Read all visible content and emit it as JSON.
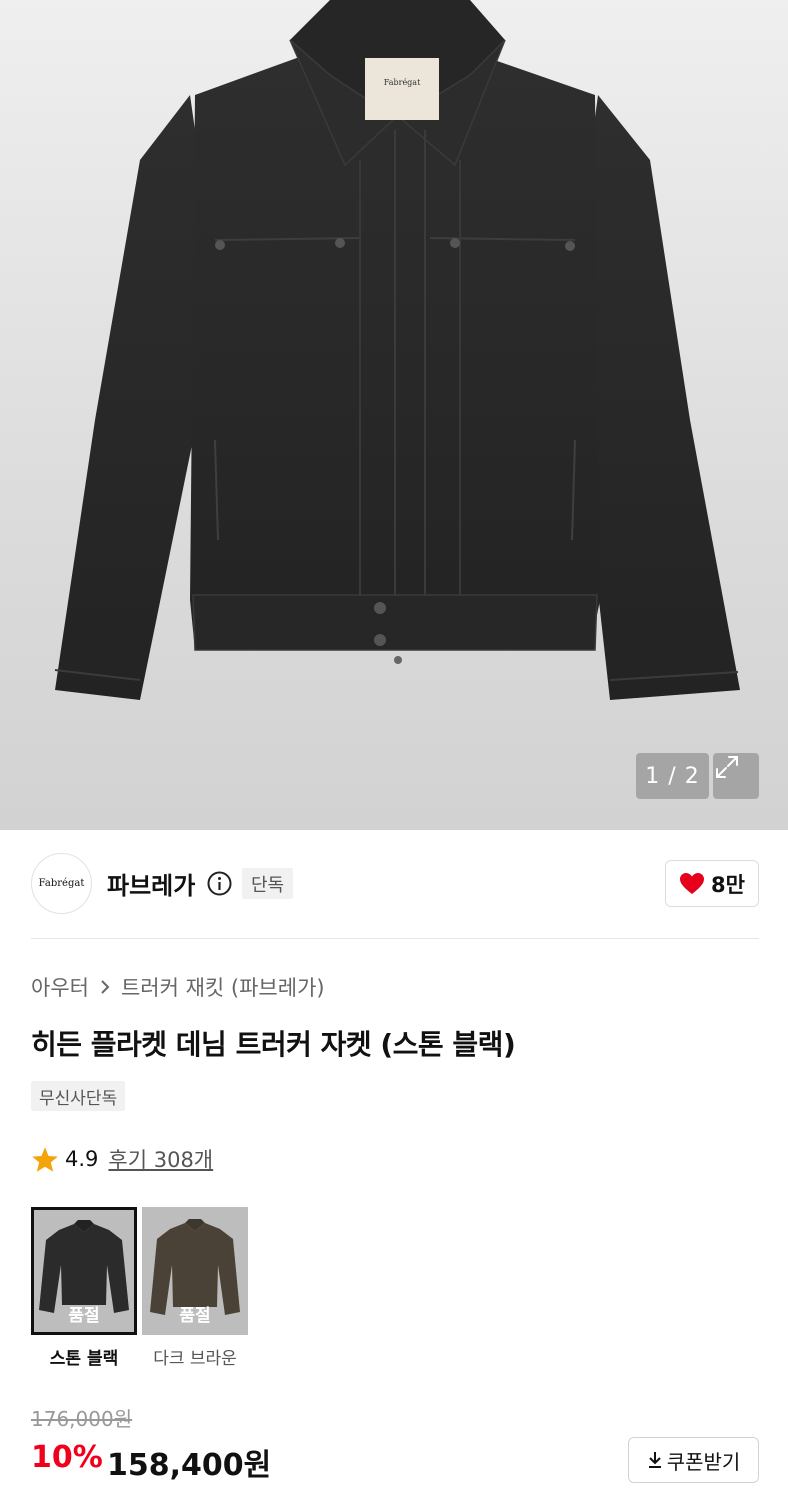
{
  "gallery": {
    "counter": "1 / 2",
    "label_tag": "Fabrégat",
    "expand_icon": "expand-icon"
  },
  "brand": {
    "logo_text": "Fabrégat",
    "name": "파브레가",
    "exclusive_badge": "단독",
    "likes": "8만",
    "like_color": "#e6001b"
  },
  "breadcrumb": {
    "category": "아우터",
    "subcategory": "트러커 재킷 (파브레가)"
  },
  "product": {
    "title": "히든 플라켓 데님 트러커 자켓 (스톤 블랙)",
    "tag": "무신사단독",
    "rating": "4.9",
    "reviews": "후기 308개",
    "star_color": "#f5a30b"
  },
  "colors": [
    {
      "name": "스톤 블랙",
      "status": "품절",
      "selected": true,
      "swatch": "#2b2b2b"
    },
    {
      "name": "다크 브라운",
      "status": "품절",
      "selected": false,
      "swatch": "#4a4236"
    }
  ],
  "price": {
    "original": "176,000원",
    "discount": "10%",
    "sale": "158,400원",
    "discount_color": "#f1001c"
  },
  "coupon": {
    "label": "쿠폰받기"
  }
}
